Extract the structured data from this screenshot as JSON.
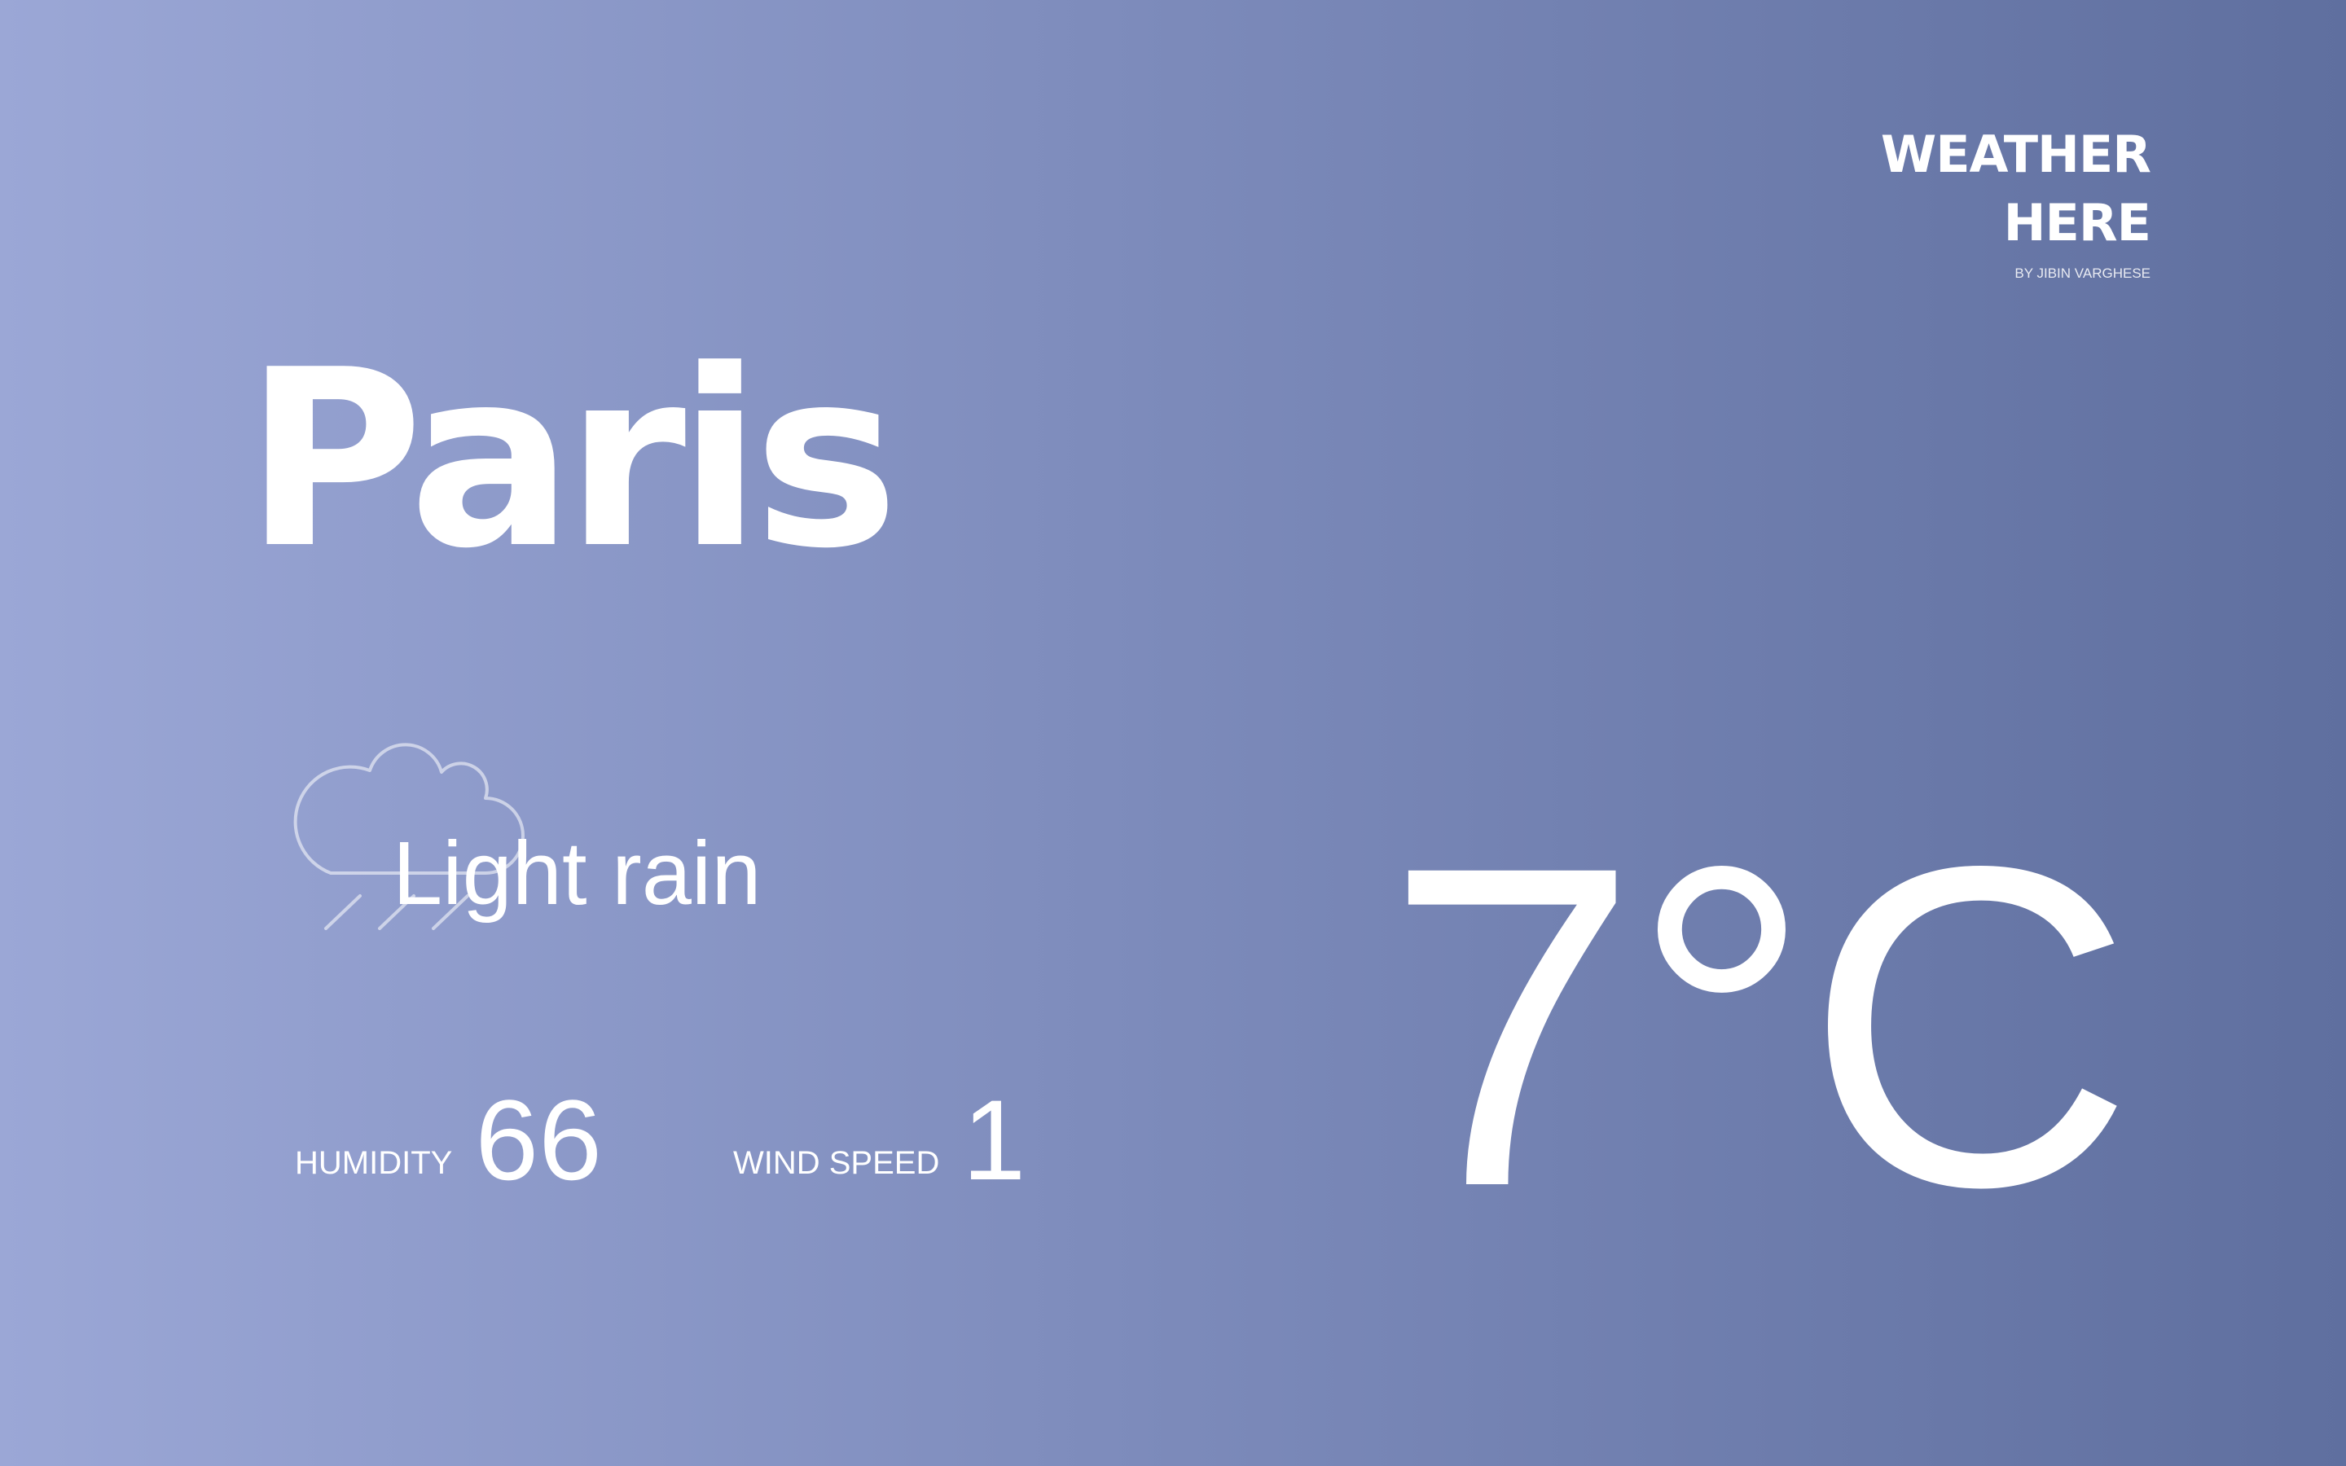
{
  "brand": {
    "line1": "WEATHER",
    "line2": "HERE",
    "author": "BY JIBIN VARGHESE"
  },
  "city": "Paris",
  "condition": {
    "text": "Light rain",
    "icon": "cloud-rain-icon"
  },
  "stats": {
    "humidity_label": "HUMIDITY",
    "humidity_value": "66",
    "wind_label": "WIND SPEED",
    "wind_value": "1"
  },
  "temperature": "7°C",
  "colors": {
    "gradient_start": "#9ba7d6",
    "gradient_end": "#5f6f9f",
    "text": "#ffffff"
  }
}
